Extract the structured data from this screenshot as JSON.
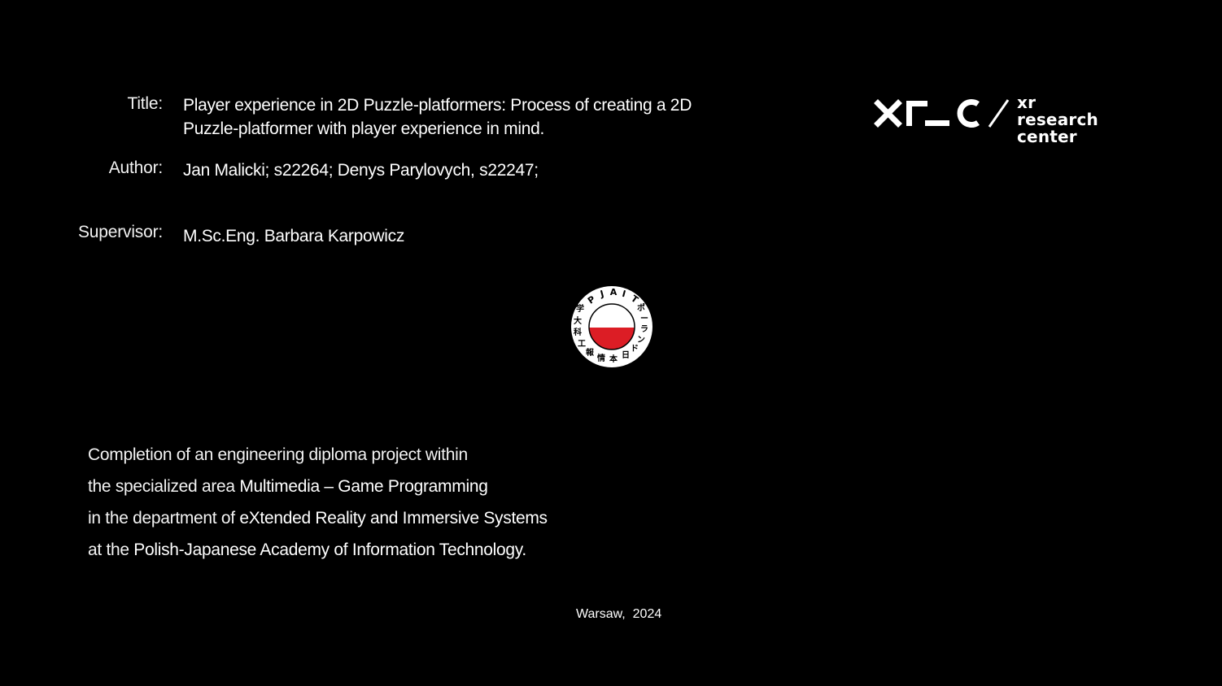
{
  "meta": {
    "title_label": "Title:",
    "title_value_line1": "Player experience in 2D Puzzle-platformers: Process of creating a 2D",
    "title_value_line2": "Puzzle-platformer with player experience in mind.",
    "author_label": "Author:",
    "author_value": "Jan Malicki; s22264; Denys Parylovych, s22247;",
    "supervisor_label": "Supervisor:",
    "supervisor_value": "M.Sc.Eng. Barbara Karpowicz"
  },
  "logo": {
    "mark": "xr_c",
    "text_line1": "xr research",
    "text_line2": "center"
  },
  "seal": {
    "top_text": "PJAIT",
    "side_text": "学大科工報情本日ドンラーポ",
    "colors": {
      "red": "#dc1d25",
      "white": "#ffffff",
      "border": "#000000"
    }
  },
  "completion": {
    "line1": "Completion of an engineering diploma project within",
    "line2_prefix": "the specialized area ",
    "line2_emphasis": "Multimedia – Game Programming",
    "line3_prefix": "in the department of ",
    "line3_emphasis": "eXtended Reality and Immersive Systems",
    "line4_prefix": "at the ",
    "line4_emphasis": "Polish-Japanese Academy of Information Technology."
  },
  "footer": {
    "place_date": "Warsaw,  2024"
  }
}
